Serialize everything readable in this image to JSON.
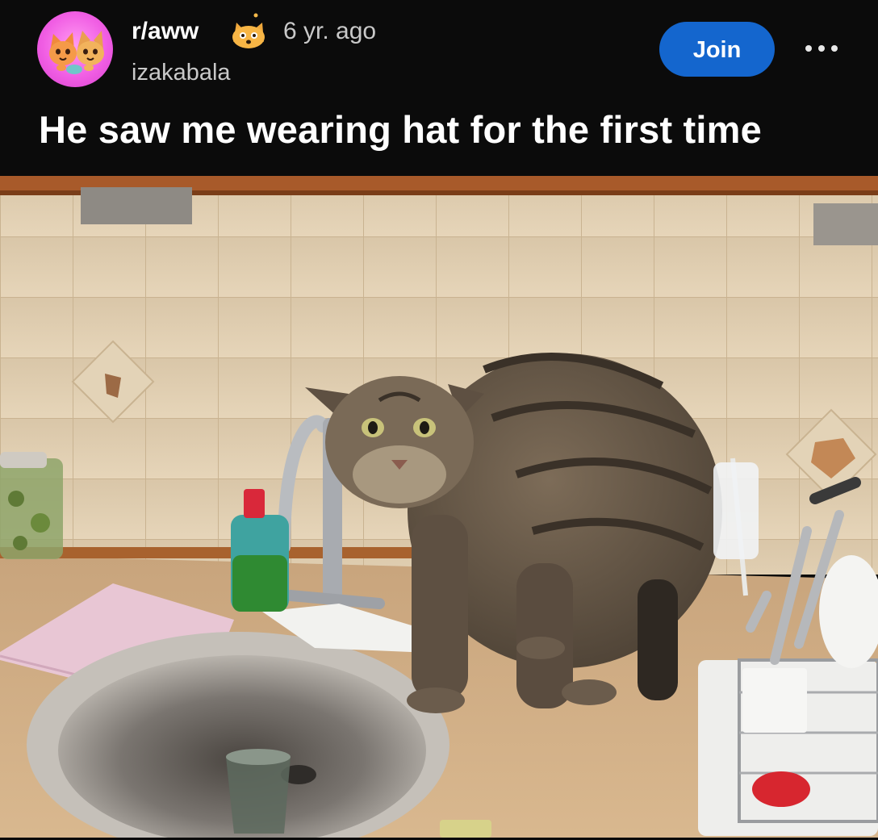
{
  "post": {
    "subreddit": "r/aww",
    "age": "6 yr. ago",
    "author": "izakabala",
    "title": "He saw me wearing hat for the first time",
    "join_label": "Join",
    "more_label": "..."
  },
  "icons": {
    "avatar": "subreddit-avatar-cats",
    "subreddit_badge": "cat-face-icon",
    "more": "more-options-icon"
  },
  "colors": {
    "background": "#0b0b0b",
    "join_button": "#1466ce",
    "avatar_pink": "#f15fe4"
  }
}
